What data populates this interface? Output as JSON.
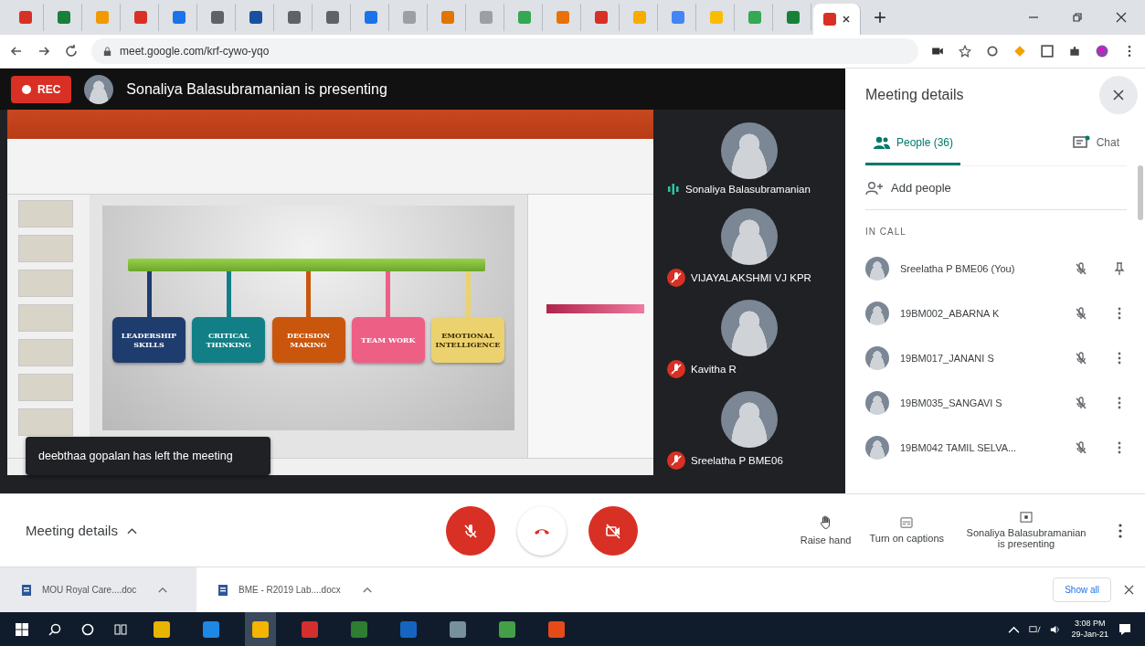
{
  "browser": {
    "tabs": [
      {
        "color": "#d93025",
        "selected": false
      },
      {
        "color": "#188038",
        "selected": false
      },
      {
        "color": "#f29900",
        "selected": false
      },
      {
        "color": "#d93025",
        "selected": false
      },
      {
        "color": "#1a73e8",
        "selected": false
      },
      {
        "color": "#5f6368",
        "selected": false
      },
      {
        "color": "#1a4fa0",
        "selected": false
      },
      {
        "color": "#5f6368",
        "selected": false
      },
      {
        "color": "#5f6368",
        "selected": false
      },
      {
        "color": "#1a73e8",
        "selected": false
      },
      {
        "color": "#9aa0a6",
        "selected": false
      },
      {
        "color": "#e37400",
        "selected": false
      },
      {
        "color": "#9aa0a6",
        "selected": false
      },
      {
        "color": "#34a853",
        "selected": false
      },
      {
        "color": "#e8710a",
        "selected": false
      },
      {
        "color": "#d93025",
        "selected": false
      },
      {
        "color": "#f9ab00",
        "selected": false
      },
      {
        "color": "#4285f4",
        "selected": false
      },
      {
        "color": "#fbbc04",
        "selected": false
      },
      {
        "color": "#34a853",
        "selected": false
      },
      {
        "color": "#188038",
        "selected": false
      },
      {
        "color": "#d93025",
        "selected": true
      }
    ],
    "url": "meet.google.com/krf-cywo-yqo"
  },
  "presentation": {
    "rec_label": "REC",
    "presenter_text": "Sonaliya Balasubramanian is presenting",
    "topics": [
      {
        "label": "LEADERSHIP SKILLS",
        "color": "#1f3c6e"
      },
      {
        "label": "CRITICAL THINKING",
        "color": "#127f86"
      },
      {
        "label": "DECISION MAKING",
        "color": "#c9560c"
      },
      {
        "label": "TEAM WORK",
        "color": "#ee5f86"
      },
      {
        "label": "EMOTIONAL INTELLIGENCE",
        "color": "#ecd26e"
      }
    ],
    "toast": "deebthaa gopalan has left the meeting"
  },
  "tiles": [
    {
      "name": "Sonaliya Balasubramanian",
      "muted": false
    },
    {
      "name": "VIJAYALAKSHMI VJ KPR",
      "muted": true
    },
    {
      "name": "Kavitha R",
      "muted": true
    },
    {
      "name": "Sreelatha P BME06",
      "muted": true
    }
  ],
  "panel": {
    "title": "Meeting details",
    "tabs": [
      {
        "label": "People (36)",
        "kind": "people",
        "selected": true
      },
      {
        "label": "Chat",
        "kind": "chat",
        "selected": false
      }
    ],
    "add_people": "Add people",
    "section": "IN CALL",
    "people": [
      {
        "name": "Sreelatha P BME06 (You)",
        "muted": true,
        "kind": "pinnable"
      },
      {
        "name": "19BM002_ABARNA K",
        "muted": true,
        "kind": "other"
      },
      {
        "name": "19BM017_JANANI S",
        "muted": true,
        "kind": "other"
      },
      {
        "name": "19BM035_SANGAVI S",
        "muted": true,
        "kind": "other"
      },
      {
        "name": "19BM042 TAMIL SELVA...",
        "muted": true,
        "kind": "other"
      }
    ]
  },
  "controls": {
    "details_label": "Meeting details",
    "mic_on": false,
    "camera_on": false,
    "actions": [
      {
        "kind": "hand",
        "label": "Raise hand"
      },
      {
        "kind": "captions",
        "label": "Turn on captions"
      },
      {
        "kind": "present",
        "label": "Sonaliya Balasubramanian is presenting"
      }
    ]
  },
  "downloads": {
    "files": [
      "MOU Royal Care....doc",
      "BME - R2019 Lab....docx"
    ],
    "show_all": "Show all"
  },
  "taskbar": {
    "apps": [
      {
        "color": "#e8b400",
        "selected": false
      },
      {
        "color": "#1e88e5",
        "selected": false
      },
      {
        "color": "#f4b400",
        "selected": true
      },
      {
        "color": "#d32f2f",
        "selected": false
      },
      {
        "color": "#2e7d32",
        "selected": false
      },
      {
        "color": "#1565c0",
        "selected": false
      },
      {
        "color": "#78909c",
        "selected": false
      },
      {
        "color": "#43a047",
        "selected": false
      },
      {
        "color": "#e64a19",
        "selected": false
      }
    ],
    "time": "3:08 PM",
    "date": "29-Jan-21"
  }
}
